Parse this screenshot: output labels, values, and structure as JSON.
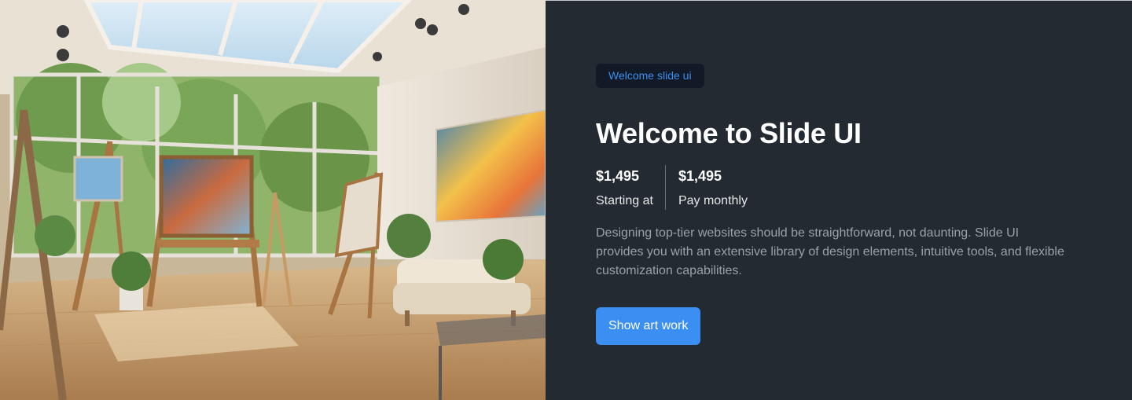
{
  "hero": {
    "badge": "Welcome slide ui",
    "title": "Welcome to Slide UI",
    "prices": [
      {
        "amount": "$1,495",
        "label": "Starting at"
      },
      {
        "amount": "$1,495",
        "label": "Pay monthly"
      }
    ],
    "description": "Designing top-tier websites should be straightforward, not daunting. Slide UI provides you with an extensive library of design elements, intuitive tools, and flexible customization capabilities.",
    "cta_label": "Show art work"
  },
  "colors": {
    "panel_bg": "#232a31",
    "badge_bg": "#111a26",
    "accent": "#3b8ff2",
    "muted_text": "#9aa1a9"
  }
}
